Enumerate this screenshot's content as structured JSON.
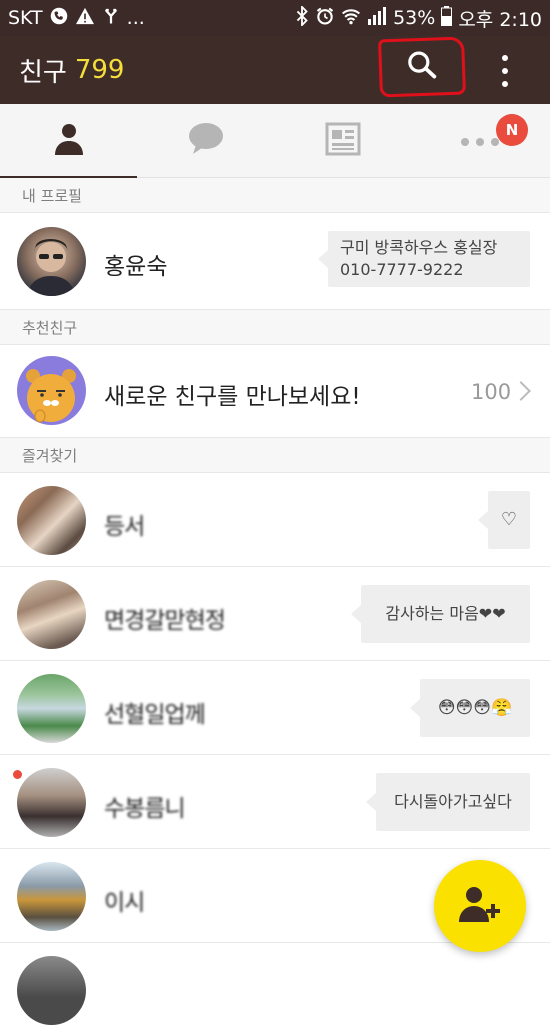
{
  "status_bar": {
    "carrier": "SKT",
    "dots": "...",
    "battery": "53%",
    "time": "오후 2:10"
  },
  "app_bar": {
    "title": "친구",
    "count": "799"
  },
  "tabs": {
    "more_badge": "N"
  },
  "sections": {
    "my_profile": "내 프로필",
    "recommended": "추천친구",
    "favorites": "즐겨찾기"
  },
  "my_profile": {
    "name": "홍윤숙",
    "status_line1": "구미 방콕하우스 홍실장",
    "status_line2": "010-7777-9222"
  },
  "recommended": {
    "text": "새로운 친구를 만나보세요!",
    "count": "100"
  },
  "favorites": [
    {
      "name": "등서",
      "status": "♡"
    },
    {
      "name": "면경갈맏현정",
      "status": "감사하는 마음❤❤"
    },
    {
      "name": "선혈일업께",
      "status": "😳😳😳😤"
    },
    {
      "name": "수봉름니",
      "status": "다시돌아가고싶다"
    },
    {
      "name": "이시",
      "status": ""
    }
  ],
  "colors": {
    "app_bar": "#3e2c29",
    "count": "#f5dd3c",
    "badge": "#e94b3c",
    "fab": "#fae100",
    "highlight": "#e0101a"
  }
}
